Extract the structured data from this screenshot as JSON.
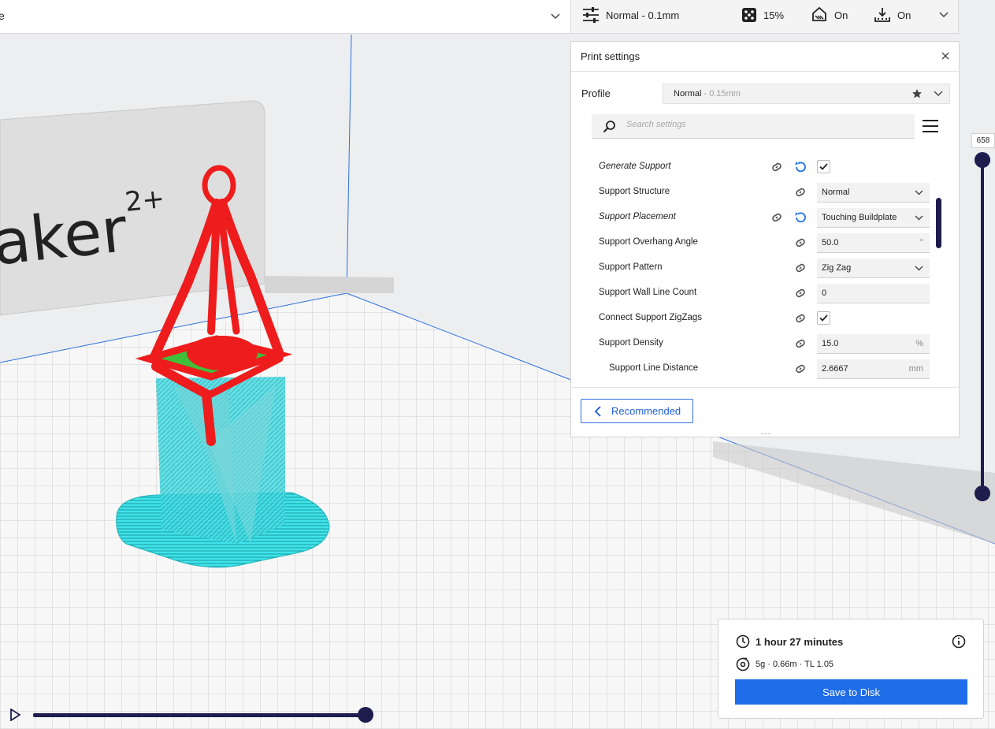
{
  "topbar": {
    "file_name": "e",
    "print_quality": "Normal - 0.1mm",
    "infill": "15%",
    "support": "On",
    "adhesion": "On"
  },
  "panel": {
    "title": "Print settings",
    "profile_label": "Profile",
    "profile_name": "Normal",
    "profile_suffix": " - 0.15mm",
    "search_placeholder": "Search settings",
    "recommended_label": "Recommended"
  },
  "settings": [
    {
      "label": "Generate Support",
      "type": "checkbox",
      "checked": true,
      "italic": true,
      "reset": true
    },
    {
      "label": "Support Structure",
      "type": "select",
      "value": "Normal"
    },
    {
      "label": "Support Placement",
      "type": "select",
      "value": "Touching Buildplate",
      "italic": true,
      "reset": true
    },
    {
      "label": "Support Overhang Angle",
      "type": "number",
      "value": "50.0",
      "unit": "°"
    },
    {
      "label": "Support Pattern",
      "type": "select",
      "value": "Zig Zag"
    },
    {
      "label": "Support Wall Line Count",
      "type": "number",
      "value": "0",
      "unit": ""
    },
    {
      "label": "Connect Support ZigZags",
      "type": "checkbox",
      "checked": true
    },
    {
      "label": "Support Density",
      "type": "number",
      "value": "15.0",
      "unit": "%"
    },
    {
      "label": "Support Line Distance",
      "type": "number",
      "value": "2.6667",
      "unit": "mm",
      "indent": true
    }
  ],
  "layer_slider": {
    "value": "658"
  },
  "estimate": {
    "time": "1 hour 27 minutes",
    "material": "5g · 0.66m · TL 1.05",
    "save_label": "Save to Disk"
  },
  "viewport": {
    "brand_text": "aker",
    "brand_sup": "2+"
  },
  "colors": {
    "accent": "#1f6de8",
    "slider": "#1d1d4e",
    "model_red": "#ee1c1c",
    "support_cyan": "#3fe4ea"
  }
}
